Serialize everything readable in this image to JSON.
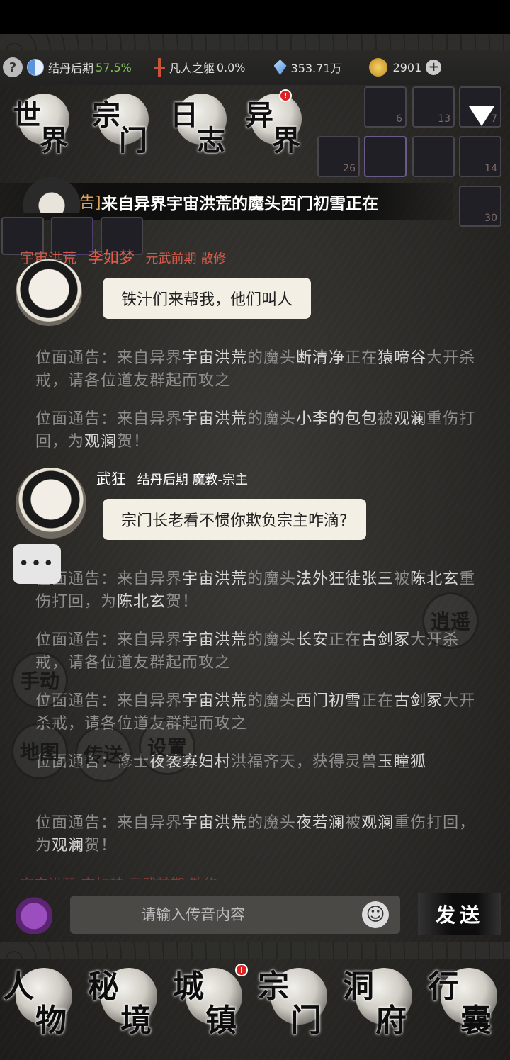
{
  "resources": {
    "realm_label": "结丹后期",
    "realm_progress": "57.5%",
    "body_label": "凡人之躯",
    "body_progress": "0.0%",
    "spirit_stones": "353.71万",
    "gold": "2901"
  },
  "top_tabs": [
    {
      "c1": "世",
      "c2": "界",
      "name": "tab-world"
    },
    {
      "c1": "宗",
      "c2": "门",
      "name": "tab-sect"
    },
    {
      "c1": "日",
      "c2": "志",
      "name": "tab-log"
    },
    {
      "c1": "异",
      "c2": "界",
      "name": "tab-other-world",
      "badge": "!"
    }
  ],
  "slots": [
    {
      "num": "6"
    },
    {
      "num": "13"
    },
    {
      "num": "7"
    },
    {
      "num": "26"
    },
    {
      "num": ""
    },
    {
      "num": ""
    },
    {
      "num": "14"
    },
    {
      "num": "30"
    }
  ],
  "marquee": {
    "prefix": "告]",
    "text": "来自异界宇宙洪荒的魔头西门初雪正在"
  },
  "chat": {
    "msg1": {
      "server": "宇宙洪荒",
      "name": "李如梦",
      "rank": "元武前期  散修",
      "text": "铁汁们来帮我，他们叫人"
    },
    "notices1": [
      {
        "prefix": "位面通告：来自异界",
        "src": "宇宙洪荒",
        "mid": "的魔头",
        "who": "断清净",
        "act": "正在",
        "place": "猿啼谷",
        "tail": "大开杀戒，请各位道友群起而攻之"
      },
      {
        "prefix": "位面通告：来自异界",
        "src": "宇宙洪荒",
        "mid": "的魔头",
        "who": "小李的包包",
        "act": "被",
        "place": "观澜",
        "tail": "重伤打回，为",
        "hero": "观澜",
        "end": "贺！"
      }
    ],
    "msg2": {
      "name": "武狂",
      "rank": "结丹后期  魔教-宗主",
      "text": "宗门长老看不惯你欺负宗主咋滴?"
    },
    "notices2": [
      {
        "prefix": "位面通告：来自异界",
        "src": "宇宙洪荒",
        "mid": "的魔头",
        "who": "法外狂徒张三",
        "act": "被",
        "place": "陈北玄",
        "tail": "重伤打回，为",
        "hero": "陈北玄",
        "end": "贺！"
      },
      {
        "prefix": "位面通告：来自异界",
        "src": "宇宙洪荒",
        "mid": "的魔头",
        "who": "长安",
        "act": "正在",
        "place": "古剑冢",
        "tail": "大开杀戒，请各位道友群起而攻之"
      },
      {
        "prefix": "位面通告：来自异界",
        "src": "宇宙洪荒",
        "mid": "的魔头",
        "who": "西门初雪",
        "act": "正在",
        "place": "古剑冢",
        "tail": "大开杀戒，请各位道友群起而攻之"
      },
      {
        "prefix": "位面通告：修士",
        "who": "夜袭寡妇村",
        "tail2": "洪福齐天，获得灵兽",
        "item": "玉瞳狐"
      },
      {
        "prefix": "位面通告：来自异界",
        "src": "宇宙洪荒",
        "mid": "的魔头",
        "who": "夜若澜",
        "act": "被",
        "place": "观澜",
        "tail": "重伤打回，为",
        "hero": "观澜",
        "end": "贺！"
      }
    ],
    "cut_line": "宇宙洪荒  李如梦  元武前期  散修",
    "side_buttons": [
      "手动",
      "地图",
      "传送",
      "设置",
      "逍遥"
    ]
  },
  "input": {
    "placeholder": "请输入传音内容",
    "send_label": "发送"
  },
  "bottom_nav": [
    {
      "c1": "人",
      "c2": "物",
      "name": "nav-character"
    },
    {
      "c1": "秘",
      "c2": "境",
      "name": "nav-secret-realm"
    },
    {
      "c1": "城",
      "c2": "镇",
      "name": "nav-town",
      "badge": "!"
    },
    {
      "c1": "宗",
      "c2": "门",
      "name": "nav-sect"
    },
    {
      "c1": "洞",
      "c2": "府",
      "name": "nav-cave"
    },
    {
      "c1": "行",
      "c2": "囊",
      "name": "nav-bag"
    }
  ],
  "colors": {
    "progress_green": "#7fc45a",
    "server_red": "#d25a4a",
    "bubble_bg": "#f3efe4",
    "notice_gray": "#8e8e8e"
  }
}
